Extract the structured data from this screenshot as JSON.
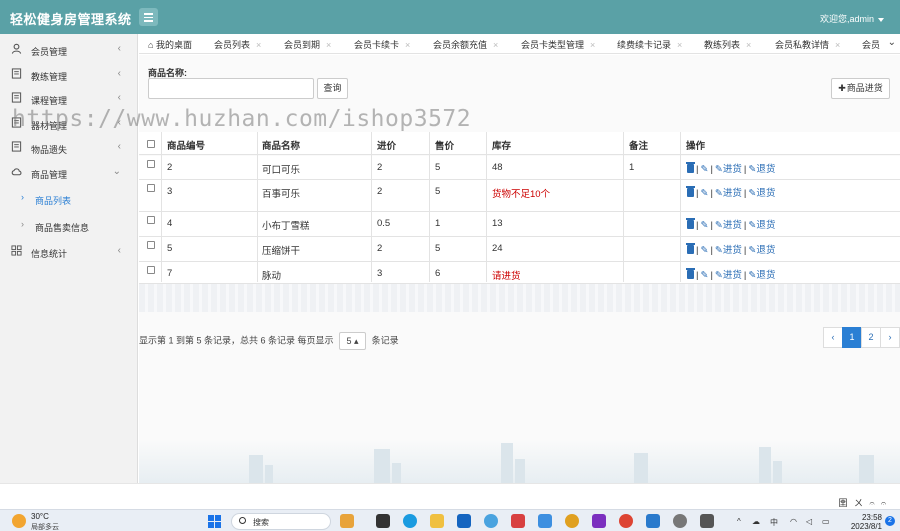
{
  "header": {
    "title": "轻松健身房管理系统",
    "welcome": "欢迎您,admin"
  },
  "sidebar": {
    "items": [
      {
        "label": "会员管理",
        "icon": "user-icon",
        "chevron": "‹"
      },
      {
        "label": "教练管理",
        "icon": "doc-icon",
        "chevron": "‹"
      },
      {
        "label": "课程管理",
        "icon": "doc-icon",
        "chevron": "‹"
      },
      {
        "label": "器材管理",
        "icon": "doc-icon",
        "chevron": "‹"
      },
      {
        "label": "物品遗失",
        "icon": "doc-icon",
        "chevron": "‹"
      },
      {
        "label": "商品管理",
        "icon": "cloud-icon",
        "chevron": "⌄"
      },
      {
        "label": "商品列表",
        "icon": "chevron-right-icon"
      },
      {
        "label": "商品售卖信息",
        "icon": "chevron-right-icon"
      },
      {
        "label": "信息统计",
        "icon": "grid-icon",
        "chevron": "‹"
      }
    ]
  },
  "tabs": [
    {
      "label": "我的桌面"
    },
    {
      "label": "会员列表"
    },
    {
      "label": "会员到期"
    },
    {
      "label": "会员卡续卡"
    },
    {
      "label": "会员余额充值"
    },
    {
      "label": "会员卡类型管理"
    },
    {
      "label": "续费续卡记录"
    },
    {
      "label": "教练列表"
    },
    {
      "label": "会员私教详情"
    },
    {
      "label": "会员"
    }
  ],
  "tab_close": "×",
  "search": {
    "label": "商品名称:",
    "button": "查询",
    "add_button": "商品进货",
    "add_icon": "✚"
  },
  "table": {
    "columns": [
      "商品编号",
      "商品名称",
      "进价",
      "售价",
      "库存",
      "备注",
      "操作"
    ],
    "rows": [
      {
        "id": "2",
        "name": "可口可乐",
        "cost": "2",
        "price": "5",
        "stock": "48",
        "stock_warn": false,
        "note": "1"
      },
      {
        "id": "3",
        "name": "百事可乐",
        "cost": "2",
        "price": "5",
        "stock": "货物不足10个",
        "stock_warn": true,
        "note": ""
      },
      {
        "id": "4",
        "name": "小布丁雪糕",
        "cost": "0.5",
        "price": "1",
        "stock": "13",
        "stock_warn": false,
        "note": ""
      },
      {
        "id": "5",
        "name": "压缩饼干",
        "cost": "2",
        "price": "5",
        "stock": "24",
        "stock_warn": false,
        "note": ""
      },
      {
        "id": "7",
        "name": "脉动",
        "cost": "3",
        "price": "6",
        "stock": "请进货",
        "stock_warn": true,
        "note": ""
      }
    ],
    "ops": {
      "sep": "|",
      "restock": "进货",
      "return": "退货"
    }
  },
  "pagination": {
    "info_prefix": "显示第 1 到第 5 条记录，总共 6 条记录 每页显示",
    "page_size": "5",
    "info_suffix": "条记录",
    "prev": "‹",
    "pages": [
      "1",
      "2"
    ],
    "current": "1",
    "next": "›"
  },
  "watermark": "https://www.huzhan.com/ishop3572",
  "taskbar": {
    "temperature": "30°C",
    "weather": "局部多云",
    "search": "搜索",
    "time": "23:58",
    "date": "2023/8/1",
    "notifications": "2",
    "ime": "圉 ㄨ 𝄐 𝄐"
  },
  "colors": {
    "header_bg": "#5aa1a6",
    "accent": "#2a7fd4",
    "warn": "#cc0000"
  }
}
